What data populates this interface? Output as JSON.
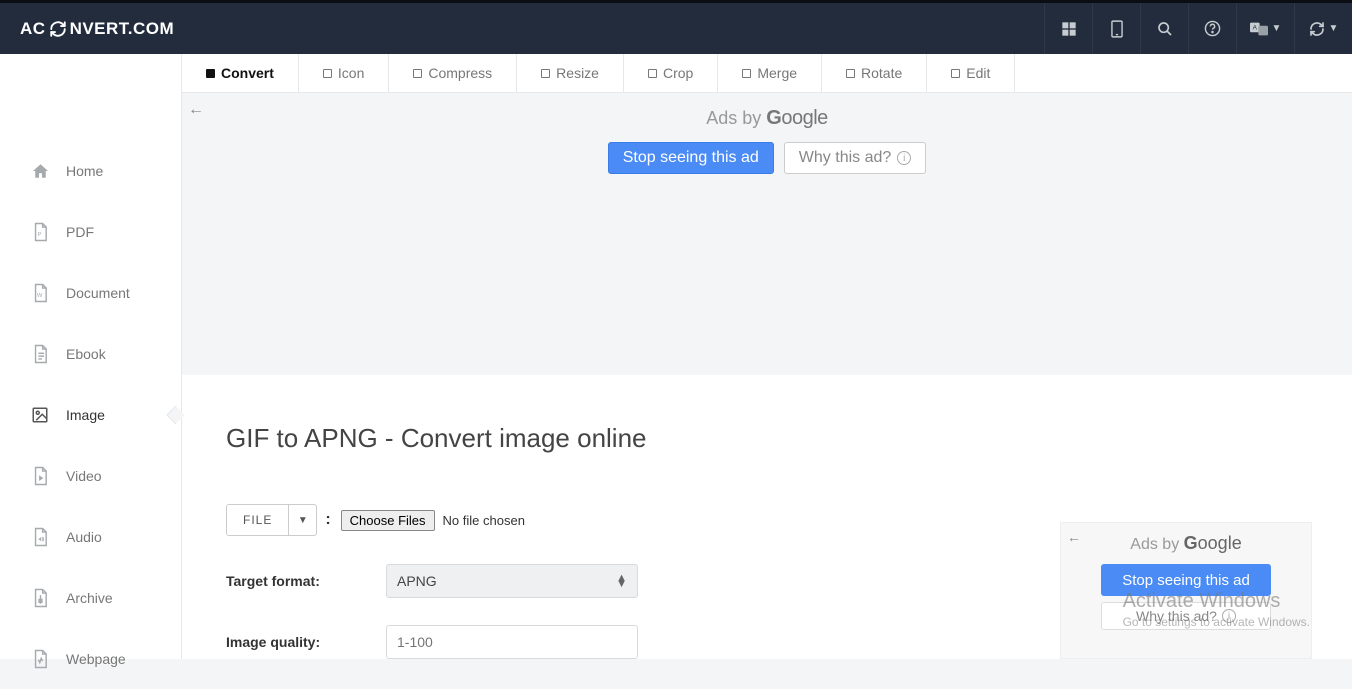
{
  "header": {
    "brand_pre": "AC",
    "brand_post": "NVERT.COM"
  },
  "sidebar": {
    "items": [
      {
        "label": "Home"
      },
      {
        "label": "PDF"
      },
      {
        "label": "Document"
      },
      {
        "label": "Ebook"
      },
      {
        "label": "Image"
      },
      {
        "label": "Video"
      },
      {
        "label": "Audio"
      },
      {
        "label": "Archive"
      },
      {
        "label": "Webpage"
      }
    ]
  },
  "tabs": [
    {
      "label": "Convert"
    },
    {
      "label": "Icon"
    },
    {
      "label": "Compress"
    },
    {
      "label": "Resize"
    },
    {
      "label": "Crop"
    },
    {
      "label": "Merge"
    },
    {
      "label": "Rotate"
    },
    {
      "label": "Edit"
    }
  ],
  "ad": {
    "adsby": "Ads by ",
    "google": "Google",
    "stop": "Stop seeing this ad",
    "why": "Why this ad?"
  },
  "page": {
    "title": "GIF to APNG - Convert image online"
  },
  "form": {
    "file_btn": "FILE",
    "choose": "Choose Files",
    "nofile": "No file chosen",
    "target_label": "Target format:",
    "target_value": "APNG",
    "quality_label": "Image quality:",
    "quality_placeholder": "1-100"
  },
  "sidead": {
    "adsby": "Ads by ",
    "google": "Google",
    "stop": "Stop seeing this ad",
    "why": "Why this ad?"
  },
  "watermark": {
    "l1": "Activate Windows",
    "l2": "Go to settings to activate Windows."
  }
}
